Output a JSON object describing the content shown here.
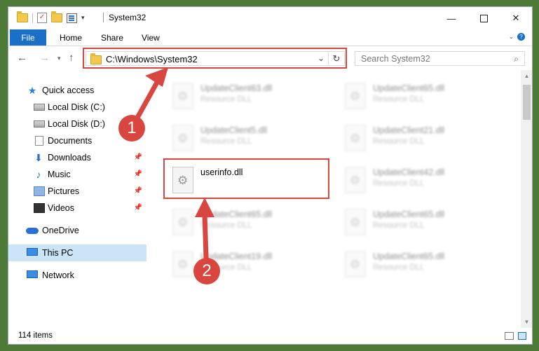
{
  "window": {
    "title": "System32",
    "minimize_label": "—",
    "close_label": "✕"
  },
  "ribbon": {
    "file_tab": "File",
    "tabs": [
      "Home",
      "Share",
      "View"
    ],
    "help_label": "?"
  },
  "address": {
    "path": "C:\\Windows\\System32",
    "search_placeholder": "Search System32"
  },
  "nav_pane": {
    "items": [
      {
        "label": "Quick access",
        "icon": "star-icon",
        "pinned": false
      },
      {
        "label": "Local Disk (C:)",
        "icon": "drive-icon",
        "pinned": false
      },
      {
        "label": "Local Disk (D:)",
        "icon": "drive-icon",
        "pinned": false
      },
      {
        "label": "Documents",
        "icon": "documents-icon",
        "pinned": false
      },
      {
        "label": "Downloads",
        "icon": "downloads-icon",
        "pinned": true
      },
      {
        "label": "Music",
        "icon": "music-icon",
        "pinned": true
      },
      {
        "label": "Pictures",
        "icon": "pictures-icon",
        "pinned": true
      },
      {
        "label": "Videos",
        "icon": "videos-icon",
        "pinned": true
      },
      {
        "label": "OneDrive",
        "icon": "onedrive-icon",
        "pinned": false
      },
      {
        "label": "This PC",
        "icon": "this-pc-icon",
        "pinned": false,
        "selected": true
      },
      {
        "label": "Network",
        "icon": "network-icon",
        "pinned": false
      }
    ]
  },
  "files": [
    {
      "name": "UpdateClient63.dll",
      "type": "Resource DLL",
      "blurred": true
    },
    {
      "name": "UpdateClient65.dll",
      "type": "Resource DLL",
      "blurred": true
    },
    {
      "name": "UpdateClient5.dll",
      "type": "Resource DLL",
      "blurred": true
    },
    {
      "name": "UpdateClient21.dll",
      "type": "Resource DLL",
      "blurred": true
    },
    {
      "name": "userinfo.dll",
      "type": "",
      "blurred": false
    },
    {
      "name": "UpdateClient42.dll",
      "type": "Resource DLL",
      "blurred": true
    },
    {
      "name": "UpdateClient65.dll",
      "type": "Resource DLL",
      "blurred": true
    },
    {
      "name": "UpdateClient65.dll",
      "type": "Resource DLL",
      "blurred": true
    },
    {
      "name": "UpdateClient19.dll",
      "type": "Resource DLL",
      "blurred": true
    },
    {
      "name": "UpdateClient65.dll",
      "type": "Resource DLL",
      "blurred": true
    }
  ],
  "status": {
    "item_count": "114 items"
  },
  "annotations": {
    "step1": "1",
    "step2": "2",
    "color": "#d9453f"
  }
}
